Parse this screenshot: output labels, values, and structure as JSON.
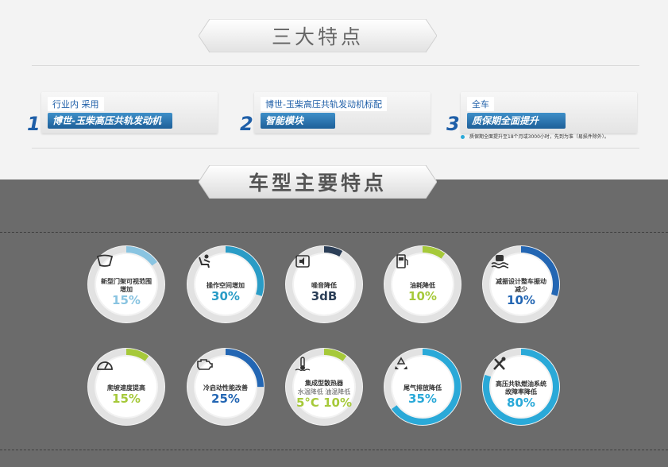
{
  "sections": {
    "title1": "三大特点",
    "title2": "车型主要特点"
  },
  "features": [
    {
      "num": "1",
      "label": "行业内 采用",
      "highlight": "博世-玉柴高压共轨发动机"
    },
    {
      "num": "2",
      "label": "博世-玉柴高压共轨发动机标配",
      "highlight": "智能模块"
    },
    {
      "num": "3",
      "label": "全车",
      "highlight": "质保期全面提升"
    }
  ],
  "note": "质保期全面提升至18个月或3000小时，先到为准（易损件除外）。",
  "circles": [
    {
      "label": "新型门架可视范围增加",
      "value": "15%",
      "color": "#89c4e1",
      "progress": 0.15,
      "icon": "windshield-icon"
    },
    {
      "label": "操作空间增加",
      "value": "30%",
      "color": "#2a9cc6",
      "progress": 0.3,
      "icon": "seat-icon"
    },
    {
      "label": "噪音降低",
      "value": "3dB",
      "color": "#2b3e57",
      "progress": 0.08,
      "icon": "speaker-icon"
    },
    {
      "label": "油耗降低",
      "value": "10%",
      "color": "#a6c93a",
      "progress": 0.1,
      "icon": "fuel-icon"
    },
    {
      "label": "减振设计整车振动减少",
      "value": "10%",
      "color": "#2366b3",
      "progress": 0.3,
      "icon": "vibration-icon"
    },
    {
      "label": "爬坡速度提高",
      "value": "15%",
      "color": "#a6c93a",
      "progress": 0.1,
      "icon": "gauge-icon"
    },
    {
      "label": "冷启动性能改善",
      "value": "25%",
      "color": "#2366b3",
      "progress": 0.25,
      "icon": "engine-icon"
    },
    {
      "label": "集成型散热器",
      "sub": "水温降低  油温降低",
      "value": "5°C  10%",
      "color": "#a6c93a",
      "progress": 0.1,
      "icon": "thermometer-icon"
    },
    {
      "label": "尾气排放降低",
      "value": "35%",
      "color": "#2aa9d8",
      "progress": 0.65,
      "icon": "recycle-icon"
    },
    {
      "label": "高压共轨燃油系统故障率降低",
      "value": "80%",
      "color": "#2aa9d8",
      "progress": 0.8,
      "icon": "tools-icon"
    }
  ]
}
